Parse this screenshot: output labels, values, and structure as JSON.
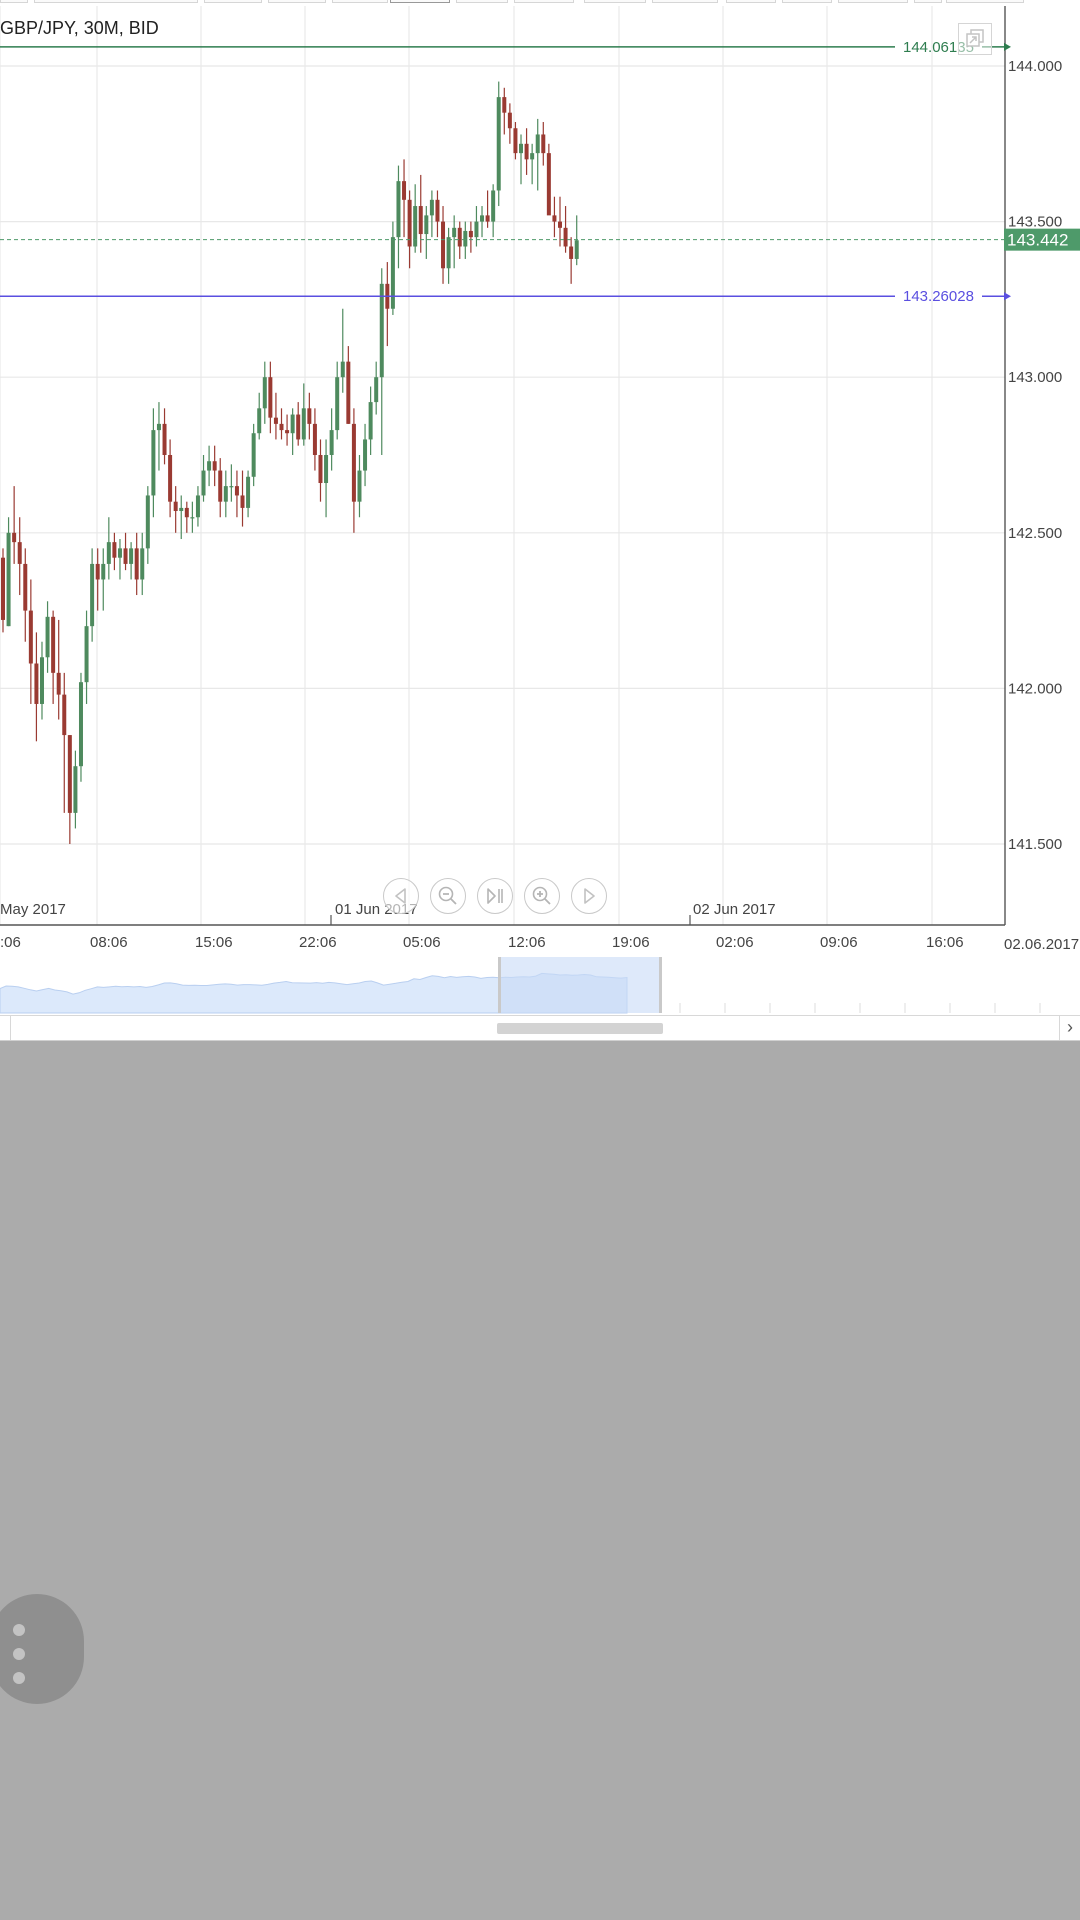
{
  "chart_title": "GBP/JPY, 30M, BID",
  "price_axis_labels": [
    "144.000",
    "143.500",
    "143.000",
    "142.500",
    "142.000",
    "141.500"
  ],
  "time_axis_labels": [
    ":06",
    "08:06",
    "15:06",
    "22:06",
    "05:06",
    "12:06",
    "19:06",
    "02:06",
    "09:06",
    "16:06"
  ],
  "date_labels": [
    "May 2017",
    "01 Jun 2017",
    "02 Jun 2017"
  ],
  "axis_corner_date": "02.06.2017",
  "current_price": {
    "value": "143.442",
    "color": "#4e9a6a"
  },
  "horizontal_lines": [
    {
      "label": "144.06135",
      "price": 144.06135,
      "color": "#2e7d4f"
    },
    {
      "label": "143.26028",
      "price": 143.26028,
      "color": "#5a4fe0"
    }
  ],
  "colors": {
    "up": "#4e8a5e",
    "down": "#9a3a32",
    "grid": "#e8e8e8",
    "navigator_fill": "#dce9fb"
  },
  "navigator_icons": [
    "scroll-left-icon",
    "zoom-out-icon",
    "go-to-end-icon",
    "zoom-in-icon",
    "scroll-right-icon"
  ],
  "overflow_menu_icon": "more-vert-icon",
  "scrollbar_right_glyph": "›",
  "chart_data": {
    "type": "candlestick",
    "symbol": "GBP/JPY",
    "timeframe": "30M",
    "price_range": [
      141.25,
      144.15
    ],
    "candles": [
      [
        142.42,
        142.45,
        142.18,
        142.22
      ],
      [
        142.2,
        142.55,
        142.2,
        142.5
      ],
      [
        142.5,
        142.65,
        142.4,
        142.47
      ],
      [
        142.47,
        142.55,
        142.3,
        142.4
      ],
      [
        142.4,
        142.45,
        142.15,
        142.25
      ],
      [
        142.25,
        142.35,
        141.95,
        142.08
      ],
      [
        142.08,
        142.18,
        141.83,
        141.95
      ],
      [
        141.95,
        142.15,
        141.9,
        142.1
      ],
      [
        142.1,
        142.28,
        142.05,
        142.23
      ],
      [
        142.23,
        142.25,
        141.95,
        142.05
      ],
      [
        142.05,
        142.22,
        141.9,
        141.98
      ],
      [
        141.98,
        142.05,
        141.6,
        141.85
      ],
      [
        141.85,
        141.85,
        141.5,
        141.6
      ],
      [
        141.6,
        141.8,
        141.55,
        141.75
      ],
      [
        141.75,
        142.05,
        141.7,
        142.02
      ],
      [
        142.02,
        142.25,
        141.95,
        142.2
      ],
      [
        142.2,
        142.45,
        142.15,
        142.4
      ],
      [
        142.4,
        142.45,
        142.25,
        142.35
      ],
      [
        142.35,
        142.45,
        142.25,
        142.4
      ],
      [
        142.4,
        142.55,
        142.35,
        142.47
      ],
      [
        142.47,
        142.5,
        142.38,
        142.42
      ],
      [
        142.42,
        142.48,
        142.35,
        142.45
      ],
      [
        142.45,
        142.5,
        142.38,
        142.4
      ],
      [
        142.4,
        142.47,
        142.35,
        142.45
      ],
      [
        142.45,
        142.5,
        142.3,
        142.35
      ],
      [
        142.35,
        142.5,
        142.3,
        142.45
      ],
      [
        142.45,
        142.65,
        142.4,
        142.62
      ],
      [
        142.62,
        142.9,
        142.55,
        142.83
      ],
      [
        142.83,
        142.92,
        142.7,
        142.85
      ],
      [
        142.85,
        142.9,
        142.72,
        142.75
      ],
      [
        142.75,
        142.8,
        142.55,
        142.6
      ],
      [
        142.6,
        142.65,
        142.5,
        142.57
      ],
      [
        142.57,
        142.62,
        142.48,
        142.58
      ],
      [
        142.58,
        142.6,
        142.5,
        142.55
      ],
      [
        142.55,
        142.6,
        142.5,
        142.55
      ],
      [
        142.55,
        142.65,
        142.52,
        142.62
      ],
      [
        142.62,
        142.75,
        142.6,
        142.7
      ],
      [
        142.7,
        142.78,
        142.65,
        142.73
      ],
      [
        142.73,
        142.78,
        142.65,
        142.7
      ],
      [
        142.7,
        142.74,
        142.55,
        142.6
      ],
      [
        142.6,
        142.7,
        142.55,
        142.65
      ],
      [
        142.65,
        142.72,
        142.6,
        142.65
      ],
      [
        142.65,
        142.7,
        142.55,
        142.62
      ],
      [
        142.62,
        142.7,
        142.52,
        142.58
      ],
      [
        142.58,
        142.7,
        142.55,
        142.68
      ],
      [
        142.68,
        142.85,
        142.65,
        142.82
      ],
      [
        142.82,
        142.95,
        142.8,
        142.9
      ],
      [
        142.9,
        143.05,
        142.85,
        143.0
      ],
      [
        143.0,
        143.05,
        142.82,
        142.87
      ],
      [
        142.87,
        142.95,
        142.8,
        142.85
      ],
      [
        142.85,
        142.9,
        142.8,
        142.83
      ],
      [
        142.83,
        142.88,
        142.78,
        142.82
      ],
      [
        142.82,
        142.9,
        142.75,
        142.88
      ],
      [
        142.88,
        142.92,
        142.78,
        142.8
      ],
      [
        142.8,
        142.98,
        142.78,
        142.9
      ],
      [
        142.9,
        142.95,
        142.8,
        142.85
      ],
      [
        142.85,
        142.9,
        142.7,
        142.75
      ],
      [
        142.75,
        142.8,
        142.6,
        142.66
      ],
      [
        142.66,
        142.8,
        142.55,
        142.75
      ],
      [
        142.75,
        142.9,
        142.7,
        142.83
      ],
      [
        142.83,
        143.05,
        142.8,
        143.0
      ],
      [
        143.0,
        143.22,
        142.95,
        143.05
      ],
      [
        143.05,
        143.1,
        142.85,
        142.85
      ],
      [
        142.85,
        142.9,
        142.5,
        142.6
      ],
      [
        142.6,
        142.75,
        142.55,
        142.7
      ],
      [
        142.7,
        142.85,
        142.65,
        142.8
      ],
      [
        142.8,
        142.97,
        142.75,
        142.92
      ],
      [
        142.92,
        143.05,
        142.88,
        143.0
      ],
      [
        143.0,
        143.35,
        142.75,
        143.3
      ],
      [
        143.3,
        143.37,
        143.1,
        143.22
      ],
      [
        143.22,
        143.5,
        143.2,
        143.45
      ],
      [
        143.45,
        143.68,
        143.35,
        143.63
      ],
      [
        143.63,
        143.7,
        143.45,
        143.57
      ],
      [
        143.57,
        143.6,
        143.35,
        143.42
      ],
      [
        143.42,
        143.62,
        143.4,
        143.55
      ],
      [
        143.55,
        143.65,
        143.4,
        143.46
      ],
      [
        143.46,
        143.55,
        143.38,
        143.52
      ],
      [
        143.52,
        143.6,
        143.45,
        143.57
      ],
      [
        143.57,
        143.6,
        143.45,
        143.5
      ],
      [
        143.5,
        143.55,
        143.3,
        143.35
      ],
      [
        143.35,
        143.48,
        143.3,
        143.45
      ],
      [
        143.45,
        143.52,
        143.35,
        143.48
      ],
      [
        143.48,
        143.5,
        143.38,
        143.42
      ],
      [
        143.42,
        143.5,
        143.38,
        143.47
      ],
      [
        143.47,
        143.5,
        143.4,
        143.45
      ],
      [
        143.45,
        143.55,
        143.42,
        143.5
      ],
      [
        143.5,
        143.55,
        143.45,
        143.52
      ],
      [
        143.52,
        143.6,
        143.48,
        143.5
      ],
      [
        143.5,
        143.62,
        143.45,
        143.6
      ],
      [
        143.6,
        143.95,
        143.55,
        143.9
      ],
      [
        143.9,
        143.93,
        143.78,
        143.85
      ],
      [
        143.85,
        143.88,
        143.75,
        143.8
      ],
      [
        143.8,
        143.82,
        143.7,
        143.72
      ],
      [
        143.72,
        143.78,
        143.62,
        143.75
      ],
      [
        143.75,
        143.8,
        143.65,
        143.7
      ],
      [
        143.7,
        143.75,
        143.62,
        143.72
      ],
      [
        143.72,
        143.83,
        143.6,
        143.78
      ],
      [
        143.78,
        143.82,
        143.68,
        143.72
      ],
      [
        143.72,
        143.75,
        143.55,
        143.52
      ],
      [
        143.52,
        143.58,
        143.45,
        143.5
      ],
      [
        143.5,
        143.58,
        143.42,
        143.48
      ],
      [
        143.48,
        143.55,
        143.4,
        143.42
      ],
      [
        143.42,
        143.45,
        143.3,
        143.38
      ],
      [
        143.38,
        143.52,
        143.36,
        143.44
      ]
    ]
  }
}
